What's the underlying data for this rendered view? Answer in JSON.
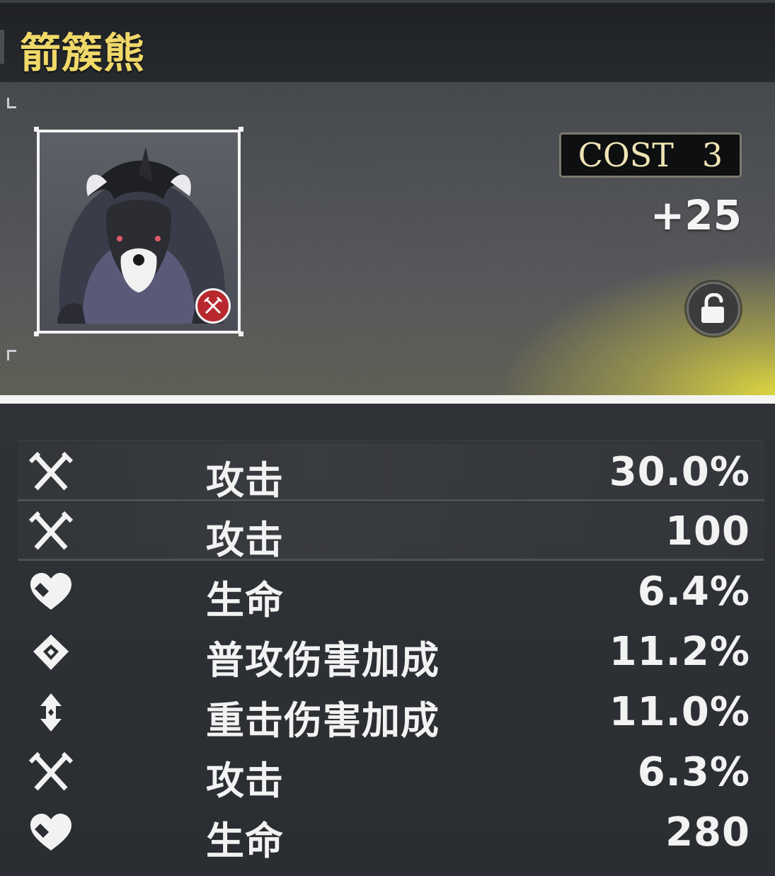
{
  "echo": {
    "name": "箭簇熊",
    "cost_label": "COST",
    "cost_value": "3",
    "level": "+25",
    "locked": false
  },
  "stats": [
    {
      "icon": "attack-icon",
      "label": "攻击",
      "value": "30.0%",
      "main": true
    },
    {
      "icon": "attack-icon",
      "label": "攻击",
      "value": "100",
      "main": true
    },
    {
      "icon": "hp-heart-icon",
      "label": "生命",
      "value": "6.4%",
      "main": false
    },
    {
      "icon": "basic-attack-icon",
      "label": "普攻伤害加成",
      "value": "11.2%",
      "main": false
    },
    {
      "icon": "heavy-attack-icon",
      "label": "重击伤害加成",
      "value": "11.0%",
      "main": false
    },
    {
      "icon": "attack-icon",
      "label": "攻击",
      "value": "6.3%",
      "main": false
    },
    {
      "icon": "hp-heart-icon",
      "label": "生命",
      "value": "280",
      "main": false
    }
  ],
  "colors": {
    "title": "#f0d869",
    "accent_gold": "#e2db3e",
    "text": "#f2f2f2"
  }
}
